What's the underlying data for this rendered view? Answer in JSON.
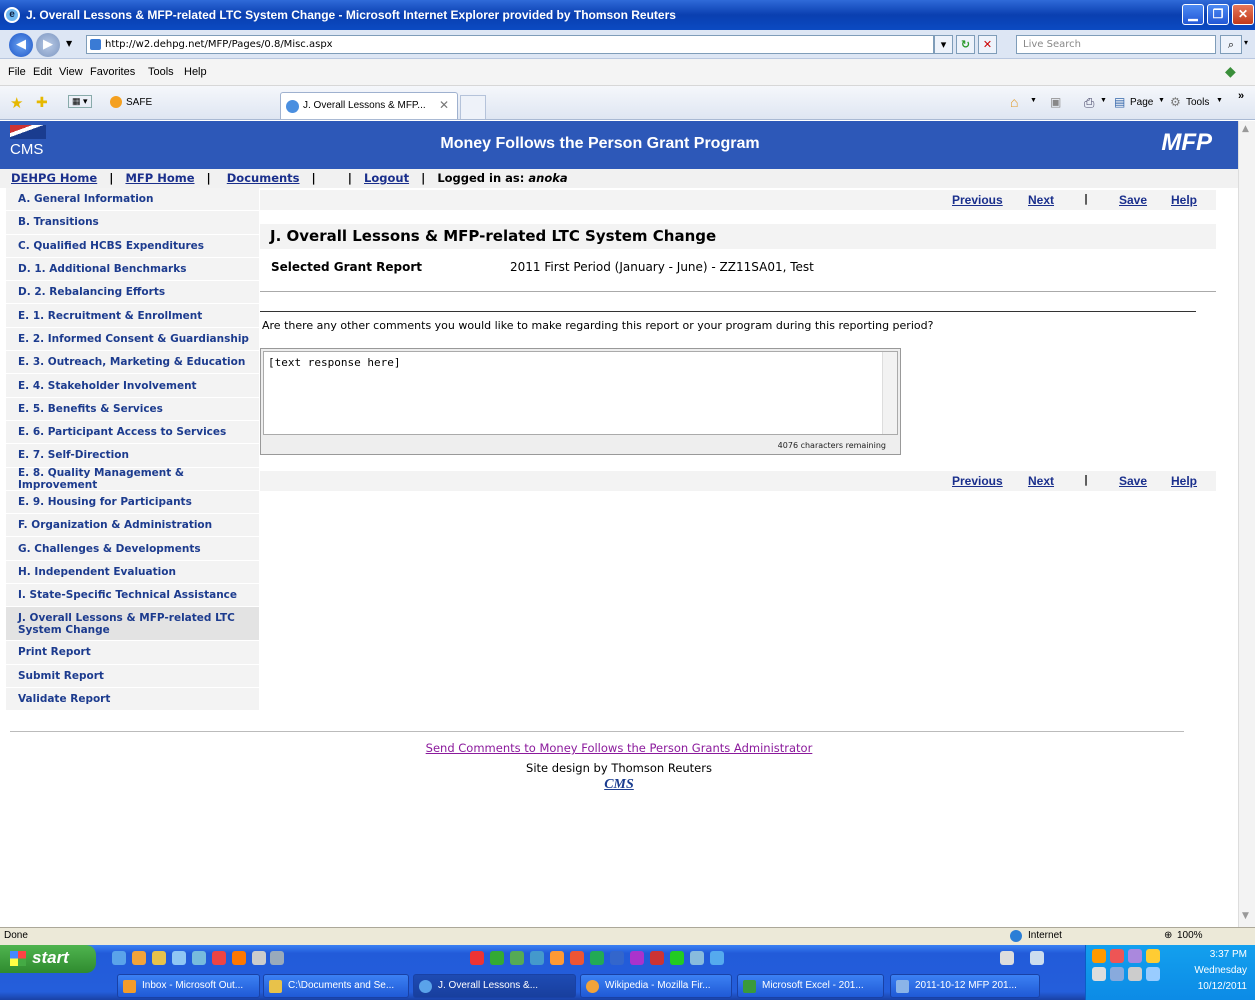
{
  "window": {
    "title": "J. Overall Lessons & MFP-related LTC System Change - Microsoft Internet Explorer provided by Thomson Reuters"
  },
  "browser": {
    "address": "http://w2.dehpg.net/MFP/Pages/0.8/Misc.aspx",
    "search_placeholder": "Live Search",
    "menu": [
      "File",
      "Edit",
      "View",
      "Favorites",
      "Tools",
      "Help"
    ],
    "fav_link": "SAFE",
    "tab_title": "J. Overall Lessons & MFP...",
    "toolbar_page": "Page",
    "toolbar_tools": "Tools"
  },
  "banner": {
    "logo": "CMS",
    "title": "Money Follows the Person Grant Program",
    "brand": "MFP"
  },
  "topnav": {
    "home": "DEHPG Home",
    "mfp_home": "MFP Home",
    "documents": "Documents",
    "logout": "Logout",
    "logged_in_label": "Logged in as:",
    "user": "anoka"
  },
  "sidebar": [
    {
      "label": "A. General Information"
    },
    {
      "label": "B. Transitions"
    },
    {
      "label": "C. Qualified HCBS Expenditures"
    },
    {
      "label": "D. 1. Additional Benchmarks"
    },
    {
      "label": "D. 2. Rebalancing Efforts"
    },
    {
      "label": "E. 1. Recruitment & Enrollment"
    },
    {
      "label": "E. 2. Informed Consent & Guardianship"
    },
    {
      "label": "E. 3. Outreach, Marketing & Education"
    },
    {
      "label": "E. 4. Stakeholder Involvement"
    },
    {
      "label": "E. 5. Benefits & Services"
    },
    {
      "label": "E. 6. Participant Access to Services"
    },
    {
      "label": "E. 7. Self-Direction"
    },
    {
      "label": "E. 8. Quality Management & Improvement"
    },
    {
      "label": "E. 9. Housing for Participants"
    },
    {
      "label": "F. Organization & Administration"
    },
    {
      "label": "G. Challenges & Developments"
    },
    {
      "label": "H. Independent Evaluation"
    },
    {
      "label": "I. State-Specific Technical Assistance"
    },
    {
      "label": "J. Overall Lessons & MFP-related LTC System Change"
    },
    {
      "label": "Print Report"
    },
    {
      "label": "Submit Report"
    },
    {
      "label": "Validate Report"
    }
  ],
  "actions": {
    "previous": "Previous",
    "next": "Next",
    "save": "Save",
    "help": "Help"
  },
  "content": {
    "heading": "J. Overall Lessons & MFP-related LTC System Change",
    "grant_label": "Selected Grant Report",
    "grant_value": "2011 First Period (January - June) - ZZ11SA01, Test",
    "question": "Are there any other comments you would like to make regarding this report or your program during this reporting period?",
    "response": "[text response here]",
    "remaining": "4076 characters remaining"
  },
  "footer": {
    "link": "Send Comments to Money Follows the Person Grants Administrator",
    "credit": "Site design by Thomson Reuters",
    "logo": "CMS"
  },
  "status": {
    "left": "Done",
    "zone": "Internet",
    "zoom": "100%"
  },
  "taskbar": {
    "start": "start",
    "tasks": [
      "Inbox - Microsoft Out...",
      "C:\\Documents and Se...",
      "J. Overall Lessons &...",
      "Wikipedia - Mozilla Fir...",
      "Microsoft Excel - 201...",
      "2011-10-12 MFP 201..."
    ],
    "time": "3:37 PM",
    "day": "Wednesday",
    "date": "10/12/2011"
  }
}
